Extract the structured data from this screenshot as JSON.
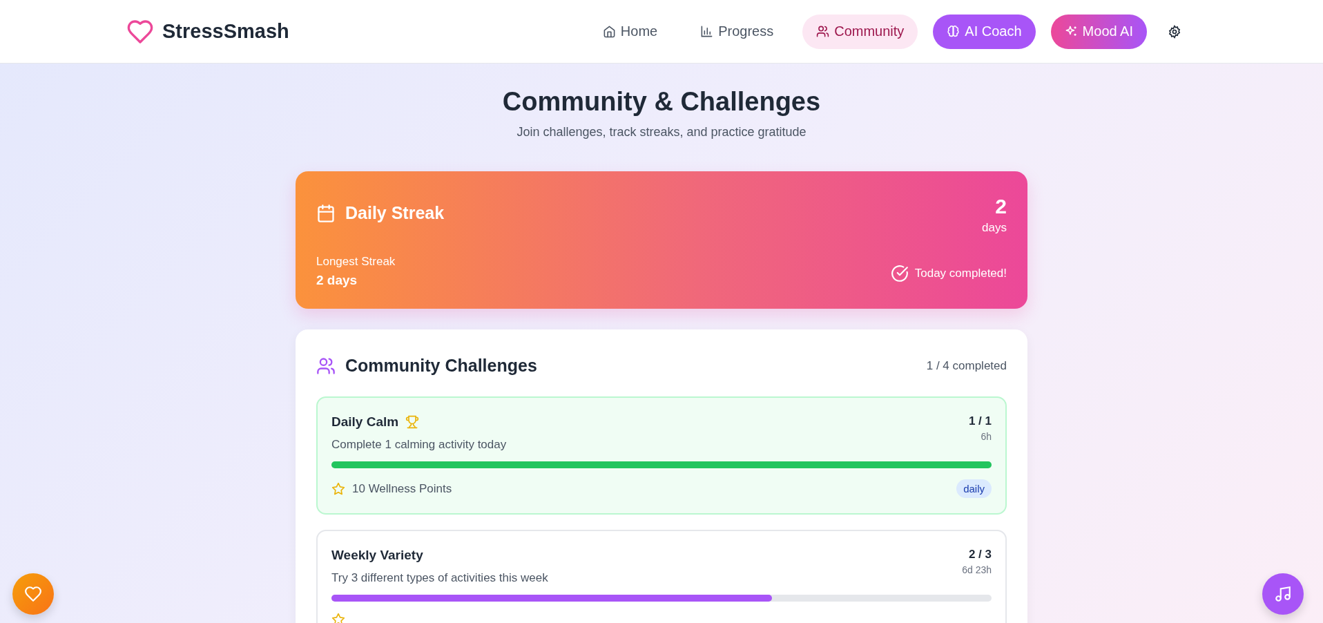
{
  "brand": {
    "name": "StressSmash"
  },
  "nav": [
    {
      "label": "Home",
      "selected": false
    },
    {
      "label": "Progress",
      "selected": false
    },
    {
      "label": "Community",
      "selected": true
    }
  ],
  "actions": [
    {
      "label": "AI Coach"
    },
    {
      "label": "Mood AI"
    }
  ],
  "page": {
    "title": "Community & Challenges",
    "subtitle": "Join challenges, track streaks, and practice gratitude"
  },
  "streak": {
    "title": "Daily Streak",
    "count": "2",
    "unit": "days",
    "longest_label": "Longest Streak",
    "longest_value": "2 days",
    "today_completed": true,
    "today_label": "Today completed!"
  },
  "challenges": {
    "title": "Community Challenges",
    "summary": "1 / 4 completed",
    "items": [
      {
        "name": "Daily Calm",
        "completed": true,
        "description": "Complete 1 calming activity today",
        "progress": "1 / 1",
        "time_left": "6h",
        "level": 1,
        "reward": "10 Wellness Points",
        "tag": "daily"
      },
      {
        "name": "Weekly Variety",
        "completed": false,
        "description": "Try 3 different types of activities this week",
        "progress": "2 / 3",
        "time_left": "6d 23h",
        "level": 0.667
      }
    ]
  }
}
